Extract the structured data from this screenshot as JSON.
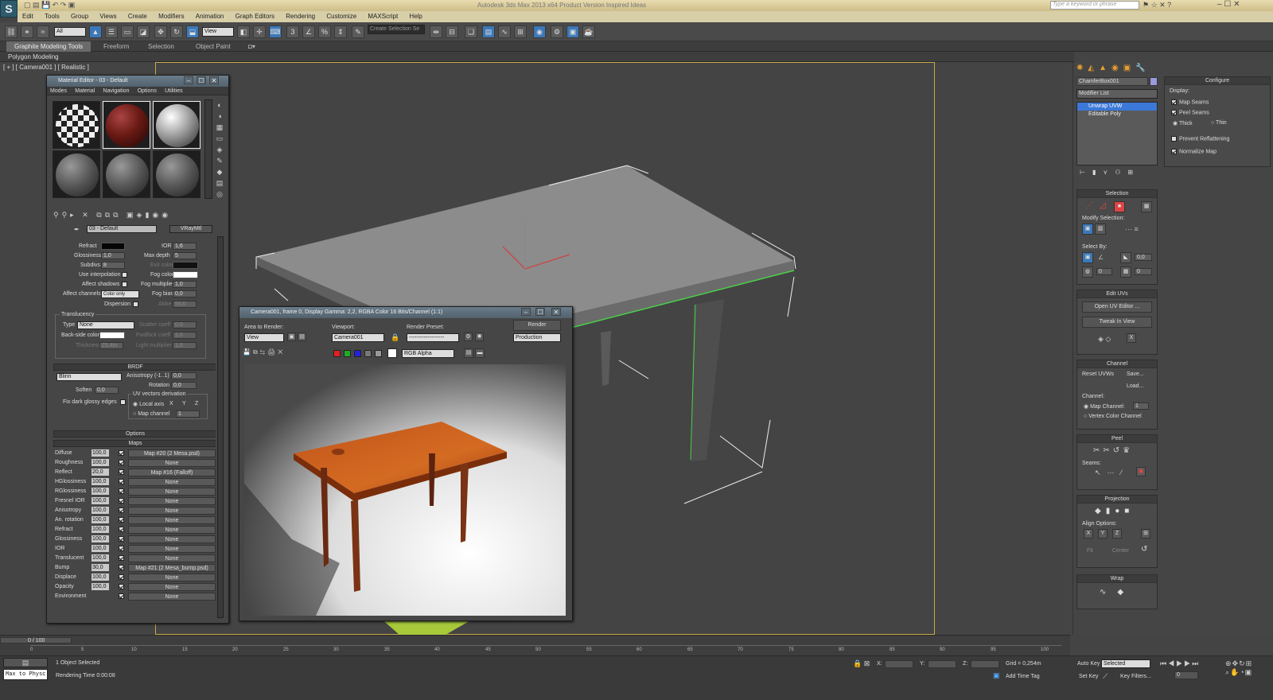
{
  "window": {
    "title": "Autodesk 3ds Max 2013 x64    Product Version    Inspired Ideas",
    "search_placeholder": "Type a keyword or phrase"
  },
  "app_icon": "3ds-max-logo",
  "menu": [
    "Edit",
    "Tools",
    "Group",
    "Views",
    "Create",
    "Modifiers",
    "Animation",
    "Graph Editors",
    "Rendering",
    "Customize",
    "MAXScript",
    "Help"
  ],
  "toolbar": {
    "filter": "All",
    "ref_coord": "View",
    "named_sel": "Create Selection Se"
  },
  "ribbon": {
    "tabs": [
      "Graphite Modeling Tools",
      "Freeform",
      "Selection",
      "Object Paint"
    ],
    "sub": "Polygon Modeling"
  },
  "viewport": {
    "label": "[ + ] [ Camera001 ] [ Realistic ]"
  },
  "material_editor": {
    "title": "Material Editor - 03 - Default",
    "menu": [
      "Modes",
      "Material",
      "Navigation",
      "Options",
      "Utilities"
    ],
    "material_name": "03 - Default",
    "material_type": "VRayMtl",
    "refraction": {
      "refract_label": "Refract",
      "ior_label": "IOR",
      "ior": "1,6",
      "gloss_label": "Glossiness",
      "gloss": "1,0",
      "maxdepth_label": "Max depth",
      "maxdepth": "5",
      "subdivs_label": "Subdivs",
      "subdivs": "8",
      "exit_label": "Exit color",
      "interp_label": "Use interpolation",
      "fogcolor_label": "Fog color",
      "shadows_label": "Affect shadows",
      "fogmult_label": "Fog multiplier",
      "fogmult": "1,0",
      "channels_label": "Affect channels",
      "channels": "Color only",
      "fogbias_label": "Fog bias",
      "fogbias": "0,0",
      "dispersion_label": "Dispersion",
      "abbe_label": "Abbe",
      "abbe": "50,0"
    },
    "translucency": {
      "title": "Translucency",
      "type_label": "Type",
      "type": "None",
      "scatter_label": "Scatter coeff",
      "scatter": "0,0",
      "backside_label": "Back-side color",
      "fwdbck_label": "Fwd/bck coeff",
      "fwdbck": "1,0",
      "thickness_label": "Thickness",
      "thickness": "25,4m",
      "light_label": "Light multiplier",
      "light": "1,0"
    },
    "brdf": {
      "title": "BRDF",
      "type": "Blinn",
      "aniso_label": "Anisotropy (-1..1)",
      "aniso": "0,0",
      "rotation_label": "Rotation",
      "rotation": "0,0",
      "soften_label": "Soften",
      "soften": "0,0",
      "uv_label": "UV vectors derivation",
      "fix_label": "Fix dark glossy edges",
      "local_label": "Local axis",
      "x": "X",
      "y": "Y",
      "z": "Z",
      "mapch_label": "Map channel",
      "mapch": "1"
    },
    "options_title": "Options",
    "maps_title": "Maps",
    "maps": [
      {
        "name": "Diffuse",
        "val": "100,0",
        "map": "Map #20 (2 Mesa.psd)"
      },
      {
        "name": "Roughness",
        "val": "100,0",
        "map": "None"
      },
      {
        "name": "Reflect",
        "val": "20,0",
        "map": "Map #16 (Falloff)"
      },
      {
        "name": "HGlossiness",
        "val": "100,0",
        "map": "None"
      },
      {
        "name": "RGlossiness",
        "val": "100,0",
        "map": "None"
      },
      {
        "name": "Fresnel IOR",
        "val": "100,0",
        "map": "None"
      },
      {
        "name": "Anisotropy",
        "val": "100,0",
        "map": "None"
      },
      {
        "name": "An. rotation",
        "val": "100,0",
        "map": "None"
      },
      {
        "name": "Refract",
        "val": "100,0",
        "map": "None"
      },
      {
        "name": "Glossiness",
        "val": "100,0",
        "map": "None"
      },
      {
        "name": "IOR",
        "val": "100,0",
        "map": "None"
      },
      {
        "name": "Translucent",
        "val": "100,0",
        "map": "None"
      },
      {
        "name": "Bump",
        "val": "30,0",
        "map": "Map #21 (2 Mesa_bump.psd)"
      },
      {
        "name": "Displace",
        "val": "100,0",
        "map": "None"
      },
      {
        "name": "Opacity",
        "val": "100,0",
        "map": "None"
      },
      {
        "name": "Environment",
        "val": "",
        "map": "None"
      }
    ]
  },
  "render_window": {
    "title": "Camera001, frame 0, Display Gamma: 2,2, RGBA Color 16 Bits/Channel (1:1)",
    "area_label": "Area to Render:",
    "area": "View",
    "viewport_label": "Viewport:",
    "viewport": "Camera001",
    "preset_label": "Render Preset:",
    "preset": "-------------------",
    "render_button": "Render",
    "mode": "Production",
    "channel": "RGB Alpha"
  },
  "command_panel": {
    "object_name": "ChamferBox001",
    "modifier_list": "Modifier List",
    "stack": [
      "Unwrap UVW",
      "Editable Poly"
    ],
    "configure": {
      "title": "Configure",
      "display": "Display:",
      "map_seams": "Map Seams",
      "peel_seams": "Peel Seams",
      "thick": "Thick",
      "thin": "Thin",
      "prevent": "Prevent Reflattening",
      "normalize": "Normalize Map"
    },
    "selection": {
      "title": "Selection",
      "modify": "Modify Selection:",
      "select_by": "Select By:",
      "v1": "0,0",
      "v2": "0",
      "v3": "0"
    },
    "edit_uvs": {
      "title": "Edit UVs",
      "open": "Open UV Editor ...",
      "tweak": "Tweak In View"
    },
    "channel": {
      "title": "Channel",
      "reset": "Reset UVWs",
      "save": "Save...",
      "load": "Load...",
      "label": "Channel:",
      "map": "Map Channel:",
      "map_val": "1",
      "vertex": "Vertex Color Channel"
    },
    "peel": {
      "title": "Peel",
      "seams": "Seams:"
    },
    "projection": {
      "title": "Projection",
      "align": "Align Options:",
      "x": "X",
      "y": "Y",
      "z": "Z",
      "fit": "Fit",
      "center": "Center"
    },
    "wrap": {
      "title": "Wrap"
    }
  },
  "timeline": {
    "frame": "0 / 100",
    "ticks": [
      "0",
      "5",
      "10",
      "15",
      "20",
      "25",
      "30",
      "35",
      "40",
      "45",
      "50",
      "55",
      "60",
      "65",
      "70",
      "75",
      "80",
      "85",
      "90",
      "95",
      "100"
    ]
  },
  "status": {
    "maxscript": "Max to Physc",
    "selected": "1 Object Selected",
    "render_time": "Rendering Time  0:00:08",
    "x_label": "X:",
    "y_label": "Y:",
    "z_label": "Z:",
    "grid": "Grid = 0,254m",
    "autokey": "Auto Key",
    "setkey": "Set Key",
    "selected_dd": "Selected",
    "keyfilters": "Key Filters...",
    "addtime": "Add Time Tag",
    "frame": "0"
  }
}
